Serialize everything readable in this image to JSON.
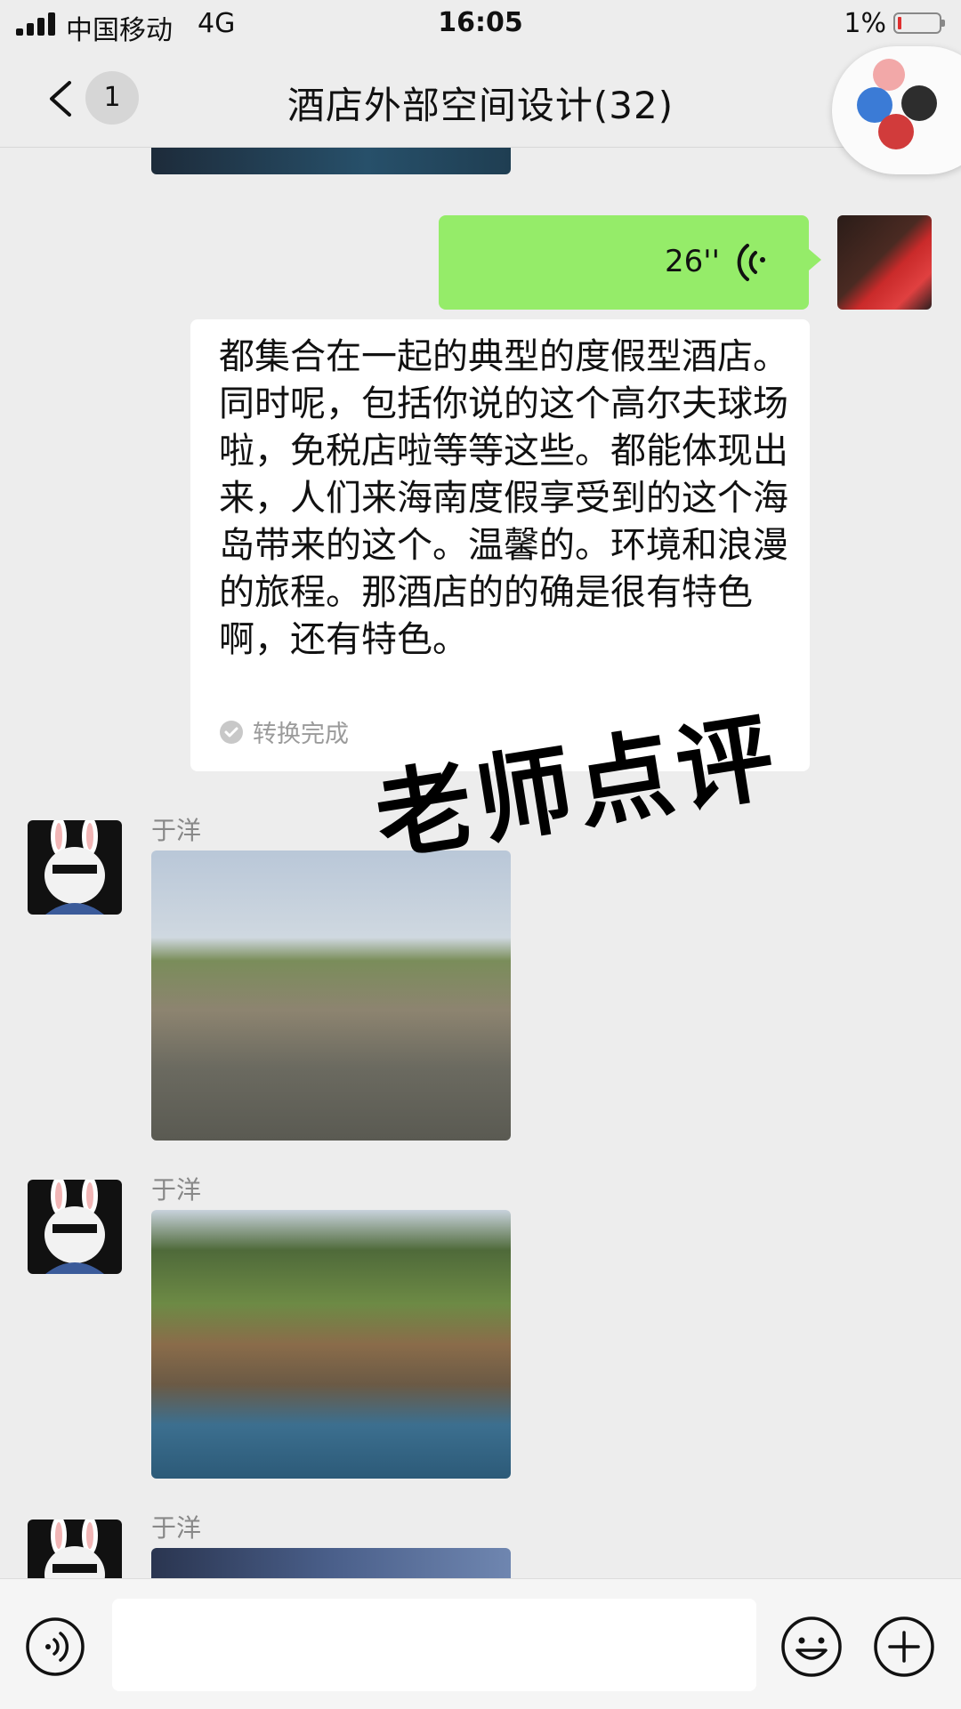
{
  "status_bar": {
    "carrier": "中国移动",
    "network": "4G",
    "time": "16:05",
    "battery_percent": "1%",
    "battery_level": 0.01
  },
  "nav": {
    "unread_count": "1",
    "title": "酒店外部空间设计(32)"
  },
  "messages": {
    "voice": {
      "duration": "26''",
      "transcript": "都集合在一起的典型的度假型酒店。同时呢，包括你说的这个高尔夫球场啦，免税店啦等等这些。都能体现出来，人们来海南度假享受到的这个海岛带来的这个。温馨的。环境和浪漫的旅程。那酒店的的确是很有特色啊，还有特色。",
      "transcript_status": "转换完成"
    },
    "sender_names": [
      "于洋",
      "于洋",
      "于洋"
    ]
  },
  "watermark": "老师点评",
  "icons": {
    "back": "back-chevron-icon",
    "voice_toggle": "voice-input-icon",
    "emoji": "emoji-icon",
    "plus": "plus-icon",
    "voice_wave": "voice-wave-icon",
    "check": "check-circle-icon"
  },
  "colors": {
    "background": "#ededed",
    "self_bubble": "#95ec69",
    "other_bubble": "#ffffff",
    "battery_low": "#e03030"
  }
}
